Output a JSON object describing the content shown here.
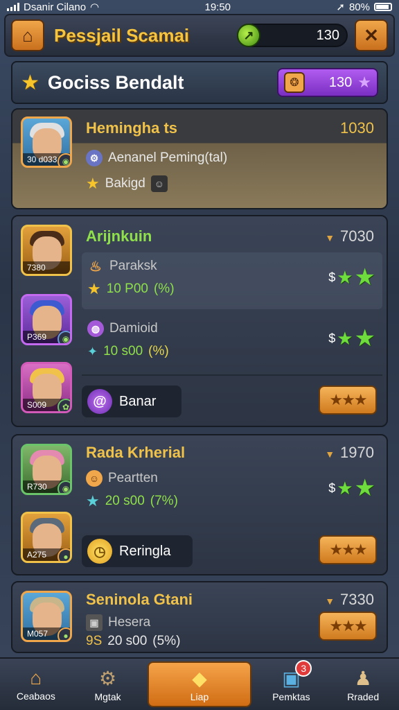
{
  "status_bar": {
    "carrier": "Dsanir Cilano",
    "time": "19:50",
    "battery": "80%"
  },
  "top_bar": {
    "title": "Pessjail Scamai",
    "currency_value": "130",
    "home_icon": "home-icon",
    "close_icon": "close-icon"
  },
  "header": {
    "title": "Gociss Bendalt",
    "pill_value": "130"
  },
  "featured": {
    "name": "Hemingha ts",
    "score": "1030",
    "portrait_tag": "30 d033",
    "line1": "Aenanel Peming(tal)",
    "line2": "Bakigd"
  },
  "card1": {
    "name": "Arijnkuin",
    "score": "7030",
    "heroes": [
      {
        "tag": "7380"
      },
      {
        "tag": "P369"
      },
      {
        "tag": "S009"
      }
    ],
    "offers": [
      {
        "title": "Paraksk",
        "amount": "10 P00",
        "pct": "(%)"
      },
      {
        "title": "Damioid",
        "amount": "10 s00",
        "pct": "(%)"
      }
    ],
    "stars_prefix": "$",
    "action_label": "Banar"
  },
  "card2": {
    "name": "Rada Krherial",
    "score": "1970",
    "heroes": [
      {
        "tag": "R730"
      },
      {
        "tag": "A275"
      }
    ],
    "offer": {
      "title": "Peartten",
      "amount": "20 s00",
      "pct": "(7%)"
    },
    "stars_prefix": "$",
    "action_label": "Reringla"
  },
  "card3": {
    "name": "Seninola Gtani",
    "score": "7330",
    "hero_tag": "M057",
    "offer": {
      "title": "Hesera",
      "prefix": "9S",
      "amount": "20 s00",
      "pct": "(5%)"
    }
  },
  "bottom_nav": [
    {
      "label": "Ceabaos"
    },
    {
      "label": "Mgtak"
    },
    {
      "label": "Liap"
    },
    {
      "label": "Pemktas",
      "badge": "3"
    },
    {
      "label": "Rraded"
    }
  ]
}
